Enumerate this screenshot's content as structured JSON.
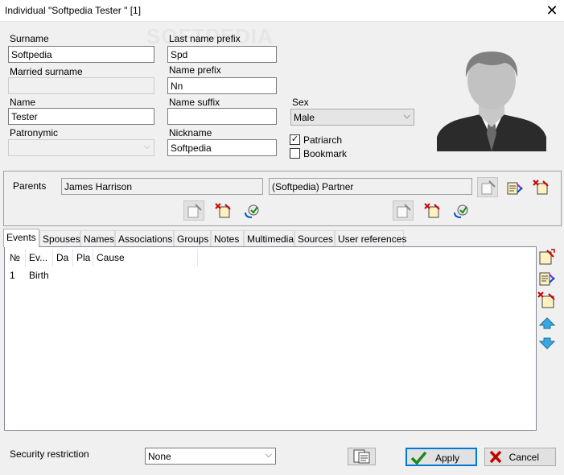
{
  "window": {
    "title": "Individual \"Softpedia Tester \" [1]",
    "close_glyph": "✕",
    "watermark": "SOFTPEDIA"
  },
  "person": {
    "surname_label": "Surname",
    "surname_value": "Softpedia",
    "last_name_prefix_label": "Last name prefix",
    "last_name_prefix_value": "Spd",
    "married_surname_label": "Married surname",
    "married_surname_value": "",
    "name_prefix_label": "Name prefix",
    "name_prefix_value": "Nn",
    "name_label": "Name",
    "name_value": "Tester",
    "name_suffix_label": "Name suffix",
    "name_suffix_value": "",
    "sex_label": "Sex",
    "sex_value": "Male",
    "patronymic_label": "Patronymic",
    "patronymic_value": "",
    "nickname_label": "Nickname",
    "nickname_value": "Softpedia",
    "patriarch_label": "Patriarch",
    "patriarch_checked": true,
    "bookmark_label": "Bookmark",
    "bookmark_checked": false,
    "check_glyph": "✓"
  },
  "parents": {
    "label": "Parents",
    "father": "James Harrison",
    "mother": "(Softpedia) Partner"
  },
  "tabs": [
    {
      "label": "Events"
    },
    {
      "label": "Spouses"
    },
    {
      "label": "Names"
    },
    {
      "label": "Associations"
    },
    {
      "label": "Groups"
    },
    {
      "label": "Notes"
    },
    {
      "label": "Multimedia"
    },
    {
      "label": "Sources"
    },
    {
      "label": "User references"
    }
  ],
  "events_table": {
    "columns": [
      "№",
      "Ev...",
      "Da",
      "Pla",
      "Cause"
    ],
    "rows": [
      {
        "no": "1",
        "event": "Birth",
        "date": "",
        "place": "",
        "cause": ""
      }
    ]
  },
  "footer": {
    "security_label": "Security restriction",
    "security_value": "None",
    "apply_label": "Apply",
    "cancel_label": "Cancel"
  },
  "colors": {
    "window_bg": "#f0f0f0",
    "accent": "#0078d7",
    "apply_check": "#1a8a1a",
    "cancel_x": "#c00000"
  },
  "icons": {
    "dropdown_arrow": "⌵"
  }
}
